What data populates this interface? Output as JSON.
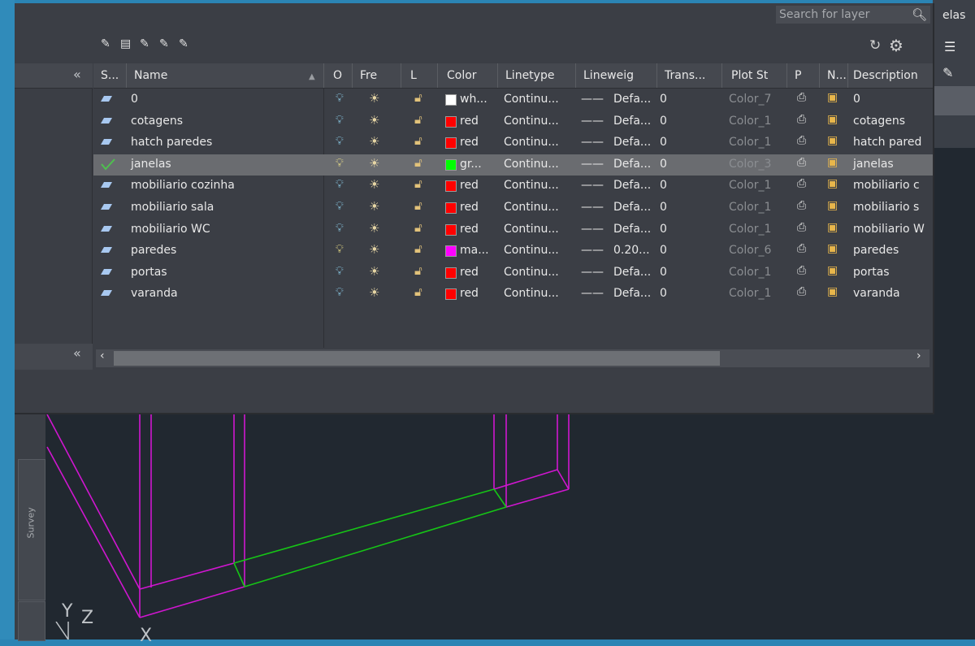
{
  "palette": {
    "search_placeholder": "Search for layer",
    "host_partial_label": "elas",
    "collapse_symbol": "«",
    "columns": [
      "S...",
      "Name",
      "O",
      "Fre",
      "L",
      "Color",
      "Linetype",
      "Lineweig",
      "Trans...",
      "Plot St",
      "P",
      "N...",
      "Description"
    ],
    "layers": [
      {
        "name": "0",
        "color_name": "wh...",
        "color": "#ffffff",
        "linetype": "Continu...",
        "lineweight": "Defa...",
        "transparency": "0",
        "plot_style": "Color_7",
        "description": "0",
        "current": false,
        "bulb": "#8fd3f0"
      },
      {
        "name": "cotagens",
        "color_name": "red",
        "color": "#ff0000",
        "linetype": "Continu...",
        "lineweight": "Defa...",
        "transparency": "0",
        "plot_style": "Color_1",
        "description": "cotagens",
        "current": false,
        "bulb": "#8fd3f0"
      },
      {
        "name": "hatch paredes",
        "color_name": "red",
        "color": "#ff0000",
        "linetype": "Continu...",
        "lineweight": "Defa...",
        "transparency": "0",
        "plot_style": "Color_1",
        "description": "hatch pared",
        "current": false,
        "bulb": "#8fd3f0"
      },
      {
        "name": "janelas",
        "color_name": "gr...",
        "color": "#00ff00",
        "linetype": "Continu...",
        "lineweight": "Defa...",
        "transparency": "0",
        "plot_style": "Color_3",
        "description": "janelas",
        "current": true,
        "bulb": "#f2e58a"
      },
      {
        "name": "mobiliario cozinha",
        "color_name": "red",
        "color": "#ff0000",
        "linetype": "Continu...",
        "lineweight": "Defa...",
        "transparency": "0",
        "plot_style": "Color_1",
        "description": "mobiliario c",
        "current": false,
        "bulb": "#8fd3f0"
      },
      {
        "name": "mobiliario sala",
        "color_name": "red",
        "color": "#ff0000",
        "linetype": "Continu...",
        "lineweight": "Defa...",
        "transparency": "0",
        "plot_style": "Color_1",
        "description": "mobiliario s",
        "current": false,
        "bulb": "#8fd3f0"
      },
      {
        "name": "mobiliario WC",
        "color_name": "red",
        "color": "#ff0000",
        "linetype": "Continu...",
        "lineweight": "Defa...",
        "transparency": "0",
        "plot_style": "Color_1",
        "description": "mobiliario W",
        "current": false,
        "bulb": "#8fd3f0"
      },
      {
        "name": "paredes",
        "color_name": "ma...",
        "color": "#ff00ff",
        "linetype": "Continu...",
        "lineweight": "0.20...",
        "transparency": "0",
        "plot_style": "Color_6",
        "description": "paredes",
        "current": false,
        "bulb": "#f2e58a"
      },
      {
        "name": "portas",
        "color_name": "red",
        "color": "#ff0000",
        "linetype": "Continu...",
        "lineweight": "Defa...",
        "transparency": "0",
        "plot_style": "Color_1",
        "description": "portas",
        "current": false,
        "bulb": "#8fd3f0"
      },
      {
        "name": "varanda",
        "color_name": "red",
        "color": "#ff0000",
        "linetype": "Continu...",
        "lineweight": "Defa...",
        "transparency": "0",
        "plot_style": "Color_1",
        "description": "varanda",
        "current": false,
        "bulb": "#8fd3f0"
      }
    ]
  },
  "canvas": {
    "side_tab_label": "Survey",
    "ucs_y": "Y",
    "ucs_z": "Z",
    "ucs_x": "X"
  }
}
